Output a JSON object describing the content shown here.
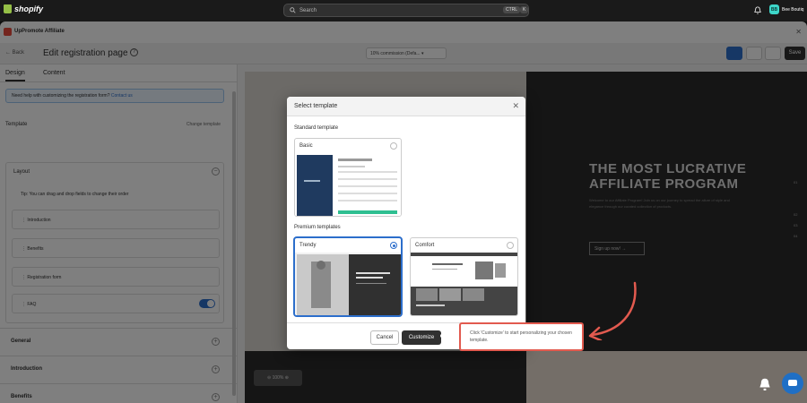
{
  "shopify": {
    "logo_text": "shopify",
    "search_placeholder": "Search",
    "shortcut_ctrl": "CTRL",
    "shortcut_key": "K",
    "store_initials": "BB",
    "store_name": "Bee Boutiq"
  },
  "app": {
    "title": "UpPromote Affiliate"
  },
  "editor": {
    "back_label": "Back",
    "page_title": "Edit registration page",
    "program_select": "10% commission (Defa...",
    "save_label": "Save",
    "tabs": [
      "Design",
      "Content"
    ],
    "notice_text": "Need help with customizing the registration form?",
    "notice_link": "Contact us",
    "template_label": "Template",
    "change_template": "Change template",
    "layout_label": "Layout",
    "tip_text": "Tip: You can drag and drop fields to change their order",
    "fields": [
      "Introduction",
      "Benefits",
      "Registration form",
      "FAQ"
    ],
    "sections": [
      "General",
      "Introduction",
      "Benefits"
    ],
    "zoom_level": "100%"
  },
  "preview": {
    "hero_title_line1": "THE MOST LUCRATIVE",
    "hero_title_line2": "AFFILIATE PROGRAM",
    "hero_sub": "Welcome to our Affiliate Program! Join us on our journey to spread the allure of style and elegance through our curated collection of products.",
    "signup_label": "Sign up now!  →",
    "side_numbers": [
      "01",
      "02",
      "03",
      "04"
    ]
  },
  "modal": {
    "title": "Select template",
    "standard_label": "Standard template",
    "premium_label": "Premium templates",
    "templates": [
      {
        "name": "Basic",
        "selected": false
      },
      {
        "name": "Trendy",
        "selected": true
      },
      {
        "name": "Comfort",
        "selected": false
      }
    ],
    "cancel_label": "Cancel",
    "customize_label": "Customize"
  },
  "callout": {
    "text": "Click 'Customize' to start personalizing your chosen template."
  },
  "colors": {
    "accent": "#2c6ecb",
    "callout_border": "#e25a4f",
    "dark": "#303030"
  }
}
